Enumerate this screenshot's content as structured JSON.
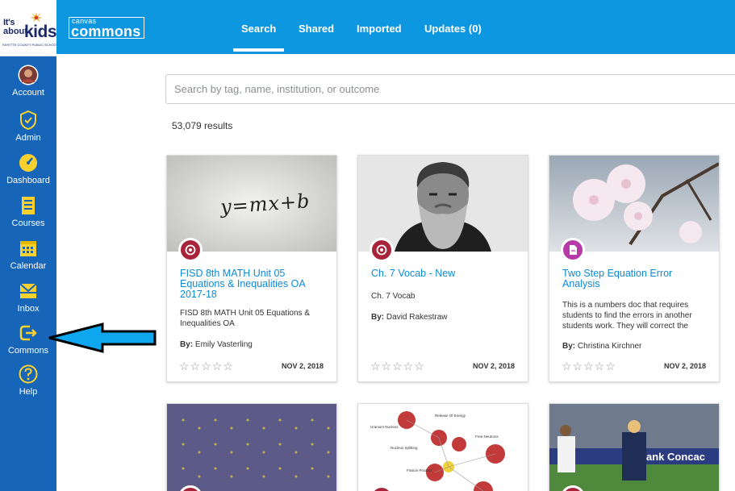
{
  "school_logo": {
    "line1": "It's",
    "line2": "about",
    "word": "kids",
    "subtitle": "FAYETTE COUNTY PUBLIC SCHOOLS"
  },
  "brand": {
    "top": "canvas",
    "bottom": "commons"
  },
  "nav": [
    {
      "label": "Account",
      "icon": "avatar"
    },
    {
      "label": "Admin",
      "icon": "shield-icon"
    },
    {
      "label": "Dashboard",
      "icon": "gauge-icon"
    },
    {
      "label": "Courses",
      "icon": "book-icon"
    },
    {
      "label": "Calendar",
      "icon": "calendar-icon"
    },
    {
      "label": "Inbox",
      "icon": "inbox-icon"
    },
    {
      "label": "Commons",
      "icon": "commons-icon"
    },
    {
      "label": "Help",
      "icon": "help-icon"
    }
  ],
  "tabs": [
    "Search",
    "Shared",
    "Imported",
    "Updates (0)"
  ],
  "search": {
    "placeholder": "Search by tag, name, institution, or outcome"
  },
  "results_count": "53,079 results",
  "cards": [
    {
      "title": "FISD 8th MATH Unit 05 Equations & Inequalities OA 2017-18",
      "description": "FISD 8th MATH Unit 05 Equations & Inequalities OA",
      "author_label": "By:",
      "author": "Emily Vasterling",
      "date": "NOV 2, 2018",
      "rating": 0,
      "thumb_text": "y=mx+b",
      "badge_color": "#a8243a",
      "badge_icon": "target-icon"
    },
    {
      "title": "Ch. 7 Vocab - New",
      "description": "Ch. 7 Vocab",
      "author_label": "By:",
      "author": "David Rakestraw",
      "date": "NOV 2, 2018",
      "rating": 0,
      "badge_color": "#a8243a",
      "badge_icon": "target-icon"
    },
    {
      "title": "Two Step Equation Error Analysis",
      "description": "This is a numbers doc that requires students to find the errors in another students work. They will correct the",
      "author_label": "By:",
      "author": "Christina Kirchner",
      "date": "NOV 2, 2018",
      "rating": 0,
      "badge_color": "#b63aa8",
      "badge_icon": "document-icon"
    }
  ],
  "second_row": {
    "nuclear_labels": [
      "Release Of Energy",
      "Uranium Nucleus",
      "Free Neutrons",
      "Nucleus Splitting",
      "Fission Product"
    ],
    "sign_text": "ank Concac"
  }
}
